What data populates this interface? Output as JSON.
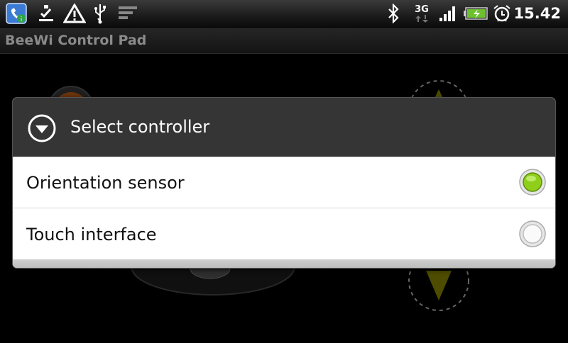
{
  "status_bar": {
    "time": "15.42",
    "network_type": "3G",
    "icons": [
      "phone-app-icon",
      "download-complete-icon",
      "warning-icon",
      "usb-icon",
      "signal-meter-icon",
      "bluetooth-icon",
      "3g-data-icon",
      "signal-strength-icon",
      "battery-charging-icon",
      "alarm-clock-icon"
    ]
  },
  "app": {
    "title": "BeeWi Control Pad"
  },
  "dialog": {
    "title": "Select controller",
    "icon": "chevron-down-circle-icon",
    "options": [
      {
        "label": "Orientation sensor",
        "selected": true
      },
      {
        "label": "Touch interface",
        "selected": false
      }
    ]
  },
  "colors": {
    "selected_radio": "#8fcf1c",
    "dialog_header": "#353535",
    "title_text": "#8a8a8a",
    "arrow": "#8c8a00"
  }
}
